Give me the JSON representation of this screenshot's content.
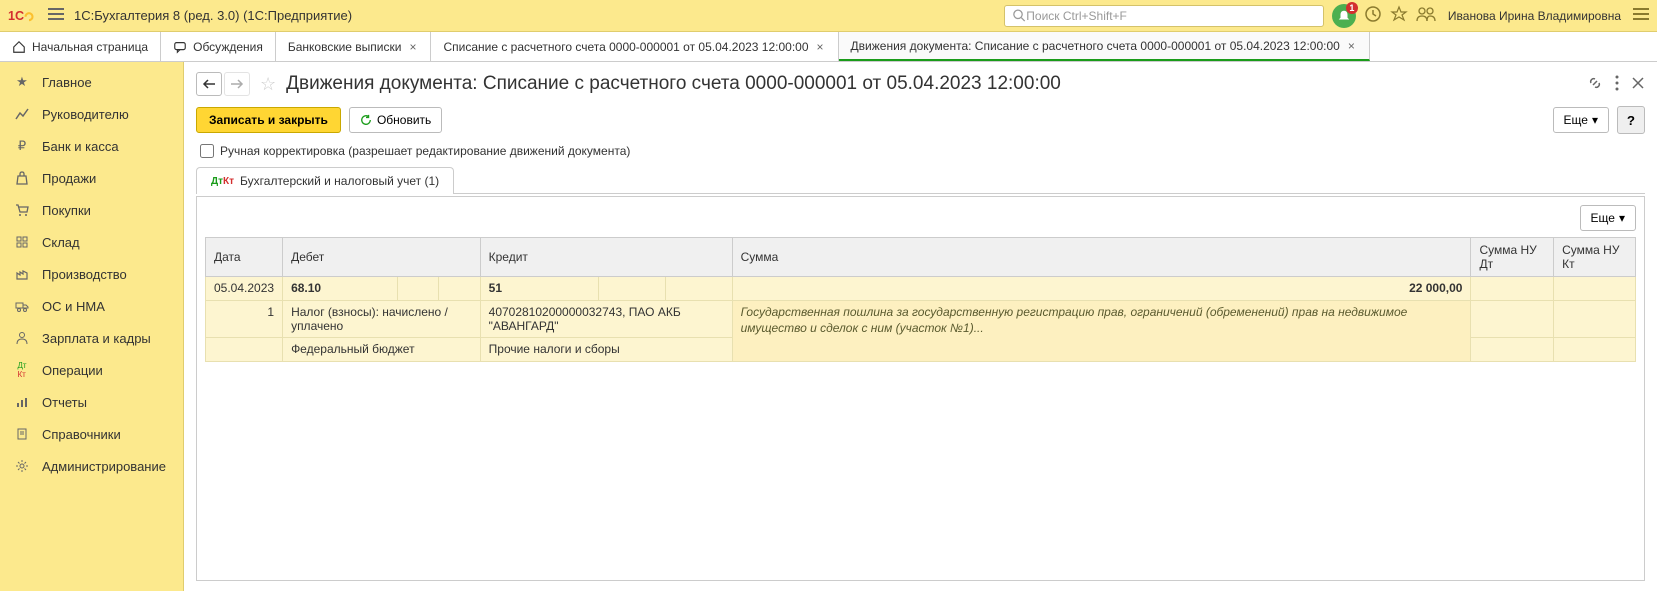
{
  "titlebar": {
    "app_title": "1С:Бухгалтерия 8 (ред. 3.0)  (1С:Предприятие)",
    "search_placeholder": "Поиск Ctrl+Shift+F",
    "notif_count": "1",
    "user_name": "Иванова Ирина Владимировна"
  },
  "tabs": [
    {
      "label": "Начальная страница",
      "closable": false
    },
    {
      "label": "Обсуждения",
      "closable": false
    },
    {
      "label": "Банковские выписки",
      "closable": true
    },
    {
      "label": "Списание с расчетного счета 0000-000001 от 05.04.2023 12:00:00",
      "closable": true
    },
    {
      "label": "Движения документа: Списание с расчетного счета 0000-000001 от 05.04.2023 12:00:00",
      "closable": true,
      "active": true
    }
  ],
  "sidebar": {
    "items": [
      {
        "label": "Главное"
      },
      {
        "label": "Руководителю"
      },
      {
        "label": "Банк и касса"
      },
      {
        "label": "Продажи"
      },
      {
        "label": "Покупки"
      },
      {
        "label": "Склад"
      },
      {
        "label": "Производство"
      },
      {
        "label": "ОС и НМА"
      },
      {
        "label": "Зарплата и кадры"
      },
      {
        "label": "Операции"
      },
      {
        "label": "Отчеты"
      },
      {
        "label": "Справочники"
      },
      {
        "label": "Администрирование"
      }
    ]
  },
  "page": {
    "title": "Движения документа: Списание с расчетного счета 0000-000001 от 05.04.2023 12:00:00",
    "save_close": "Записать и закрыть",
    "refresh": "Обновить",
    "more": "Еще",
    "help": "?",
    "checkbox_label": "Ручная корректировка (разрешает редактирование движений документа)",
    "inner_tab": "Бухгалтерский и налоговый учет (1)"
  },
  "table": {
    "headers": {
      "date": "Дата",
      "debit": "Дебет",
      "credit": "Кредит",
      "sum": "Сумма",
      "sum_nu_dt": "Сумма НУ Дт",
      "sum_nu_kt": "Сумма НУ Кт"
    },
    "row": {
      "date": "05.04.2023",
      "seq": "1",
      "debit_acc": "68.10",
      "debit_sub1": "Налог (взносы): начислено / уплачено",
      "debit_sub2": "Федеральный бюджет",
      "credit_acc": "51",
      "credit_sub1": "40702810200000032743, ПАО АКБ \"АВАНГАРД\"",
      "credit_sub2": "Прочие налоги и сборы",
      "sum": "22 000,00",
      "comment": "Государственная пошлина за государственную регистрацию прав, ограничений (обременений) прав на недвижимое имущество и сделок с ним (участок №1)..."
    }
  }
}
